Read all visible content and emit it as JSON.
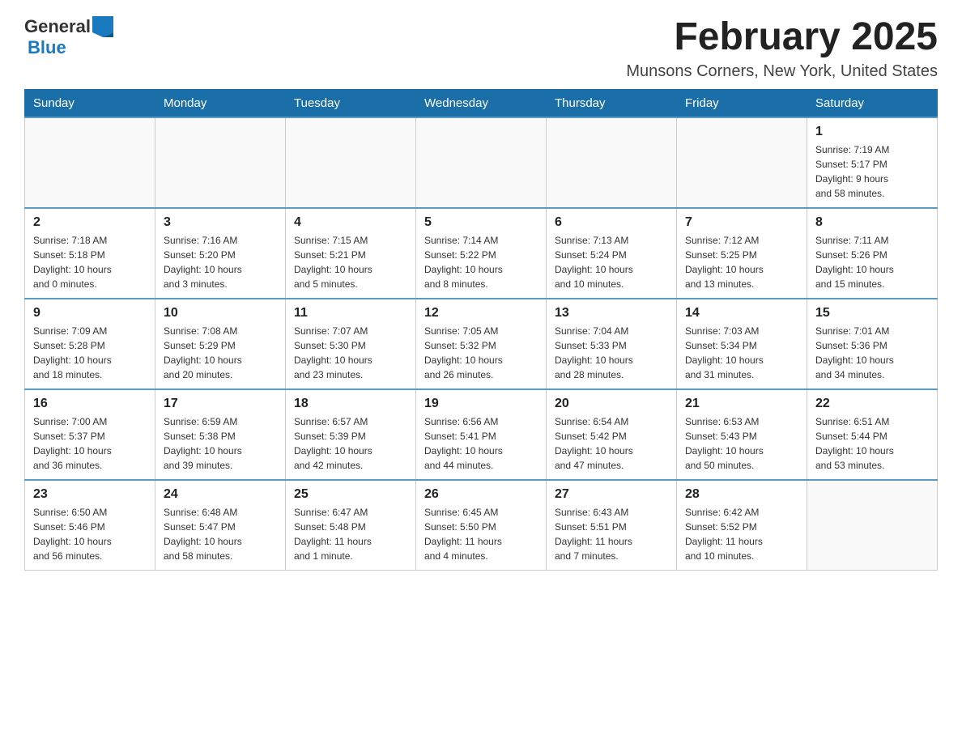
{
  "header": {
    "logo_general": "General",
    "logo_blue": "Blue",
    "month_title": "February 2025",
    "location": "Munsons Corners, New York, United States"
  },
  "weekdays": [
    "Sunday",
    "Monday",
    "Tuesday",
    "Wednesday",
    "Thursday",
    "Friday",
    "Saturday"
  ],
  "weeks": [
    [
      {
        "day": "",
        "info": ""
      },
      {
        "day": "",
        "info": ""
      },
      {
        "day": "",
        "info": ""
      },
      {
        "day": "",
        "info": ""
      },
      {
        "day": "",
        "info": ""
      },
      {
        "day": "",
        "info": ""
      },
      {
        "day": "1",
        "info": "Sunrise: 7:19 AM\nSunset: 5:17 PM\nDaylight: 9 hours\nand 58 minutes."
      }
    ],
    [
      {
        "day": "2",
        "info": "Sunrise: 7:18 AM\nSunset: 5:18 PM\nDaylight: 10 hours\nand 0 minutes."
      },
      {
        "day": "3",
        "info": "Sunrise: 7:16 AM\nSunset: 5:20 PM\nDaylight: 10 hours\nand 3 minutes."
      },
      {
        "day": "4",
        "info": "Sunrise: 7:15 AM\nSunset: 5:21 PM\nDaylight: 10 hours\nand 5 minutes."
      },
      {
        "day": "5",
        "info": "Sunrise: 7:14 AM\nSunset: 5:22 PM\nDaylight: 10 hours\nand 8 minutes."
      },
      {
        "day": "6",
        "info": "Sunrise: 7:13 AM\nSunset: 5:24 PM\nDaylight: 10 hours\nand 10 minutes."
      },
      {
        "day": "7",
        "info": "Sunrise: 7:12 AM\nSunset: 5:25 PM\nDaylight: 10 hours\nand 13 minutes."
      },
      {
        "day": "8",
        "info": "Sunrise: 7:11 AM\nSunset: 5:26 PM\nDaylight: 10 hours\nand 15 minutes."
      }
    ],
    [
      {
        "day": "9",
        "info": "Sunrise: 7:09 AM\nSunset: 5:28 PM\nDaylight: 10 hours\nand 18 minutes."
      },
      {
        "day": "10",
        "info": "Sunrise: 7:08 AM\nSunset: 5:29 PM\nDaylight: 10 hours\nand 20 minutes."
      },
      {
        "day": "11",
        "info": "Sunrise: 7:07 AM\nSunset: 5:30 PM\nDaylight: 10 hours\nand 23 minutes."
      },
      {
        "day": "12",
        "info": "Sunrise: 7:05 AM\nSunset: 5:32 PM\nDaylight: 10 hours\nand 26 minutes."
      },
      {
        "day": "13",
        "info": "Sunrise: 7:04 AM\nSunset: 5:33 PM\nDaylight: 10 hours\nand 28 minutes."
      },
      {
        "day": "14",
        "info": "Sunrise: 7:03 AM\nSunset: 5:34 PM\nDaylight: 10 hours\nand 31 minutes."
      },
      {
        "day": "15",
        "info": "Sunrise: 7:01 AM\nSunset: 5:36 PM\nDaylight: 10 hours\nand 34 minutes."
      }
    ],
    [
      {
        "day": "16",
        "info": "Sunrise: 7:00 AM\nSunset: 5:37 PM\nDaylight: 10 hours\nand 36 minutes."
      },
      {
        "day": "17",
        "info": "Sunrise: 6:59 AM\nSunset: 5:38 PM\nDaylight: 10 hours\nand 39 minutes."
      },
      {
        "day": "18",
        "info": "Sunrise: 6:57 AM\nSunset: 5:39 PM\nDaylight: 10 hours\nand 42 minutes."
      },
      {
        "day": "19",
        "info": "Sunrise: 6:56 AM\nSunset: 5:41 PM\nDaylight: 10 hours\nand 44 minutes."
      },
      {
        "day": "20",
        "info": "Sunrise: 6:54 AM\nSunset: 5:42 PM\nDaylight: 10 hours\nand 47 minutes."
      },
      {
        "day": "21",
        "info": "Sunrise: 6:53 AM\nSunset: 5:43 PM\nDaylight: 10 hours\nand 50 minutes."
      },
      {
        "day": "22",
        "info": "Sunrise: 6:51 AM\nSunset: 5:44 PM\nDaylight: 10 hours\nand 53 minutes."
      }
    ],
    [
      {
        "day": "23",
        "info": "Sunrise: 6:50 AM\nSunset: 5:46 PM\nDaylight: 10 hours\nand 56 minutes."
      },
      {
        "day": "24",
        "info": "Sunrise: 6:48 AM\nSunset: 5:47 PM\nDaylight: 10 hours\nand 58 minutes."
      },
      {
        "day": "25",
        "info": "Sunrise: 6:47 AM\nSunset: 5:48 PM\nDaylight: 11 hours\nand 1 minute."
      },
      {
        "day": "26",
        "info": "Sunrise: 6:45 AM\nSunset: 5:50 PM\nDaylight: 11 hours\nand 4 minutes."
      },
      {
        "day": "27",
        "info": "Sunrise: 6:43 AM\nSunset: 5:51 PM\nDaylight: 11 hours\nand 7 minutes."
      },
      {
        "day": "28",
        "info": "Sunrise: 6:42 AM\nSunset: 5:52 PM\nDaylight: 11 hours\nand 10 minutes."
      },
      {
        "day": "",
        "info": ""
      }
    ]
  ]
}
